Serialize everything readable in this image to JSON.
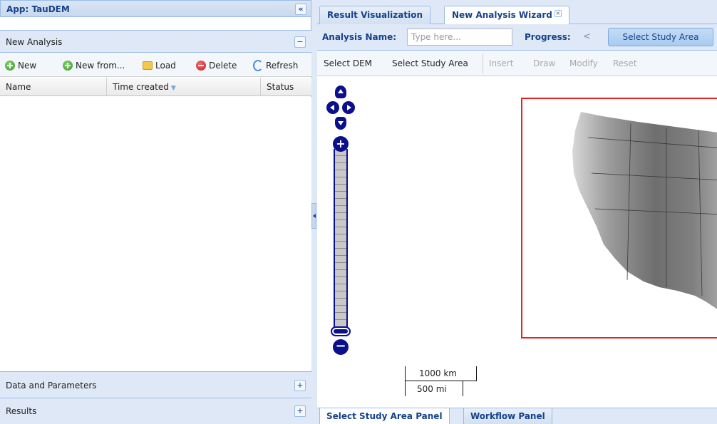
{
  "left_panel": {
    "app_title": "App: TauDEM",
    "collapse_glyph": "«",
    "new_analysis": {
      "title": "New Analysis",
      "collapse_glyph": "−",
      "toolbar": {
        "new": "New",
        "new_from": "New from...",
        "load": "Load",
        "delete": "Delete",
        "refresh": "Refresh"
      },
      "columns": {
        "name": "Name",
        "time_created": "Time created",
        "status": "Status"
      },
      "sort_indicator": "▼"
    },
    "data_and_parameters": {
      "title": "Data and Parameters",
      "expand_glyph": "+"
    },
    "results": {
      "title": "Results",
      "expand_glyph": "+"
    }
  },
  "right_panel": {
    "tabs": {
      "result_visualization": "Result Visualization",
      "new_analysis_wizard": "New Analysis Wizard",
      "close_glyph": "×"
    },
    "wizard": {
      "analysis_name_label": "Analysis Name:",
      "analysis_name_placeholder": "Type here...",
      "analysis_name_value": "",
      "progress_label": "Progress:",
      "progress_back": "<",
      "current_step": "Select Study Area"
    },
    "map_tools": {
      "select_dem": "Select DEM",
      "select_study_area": "Select Study Area",
      "insert": "Insert",
      "draw": "Draw",
      "modify": "Modify",
      "reset": "Reset"
    },
    "map": {
      "zoom_in_glyph": "+",
      "zoom_out_glyph": "−",
      "scale_km": "1000 km",
      "scale_mi": "500 mi",
      "study_area_color": "#e82020"
    },
    "bottom_tabs": {
      "select_study_area_panel": "Select Study Area Panel",
      "workflow_panel": "Workflow Panel"
    }
  },
  "colors": {
    "header_blue": "#15428b",
    "panel_bg": "#dfe8f6",
    "border": "#99bbe8",
    "map_control": "#0a0f8c"
  }
}
